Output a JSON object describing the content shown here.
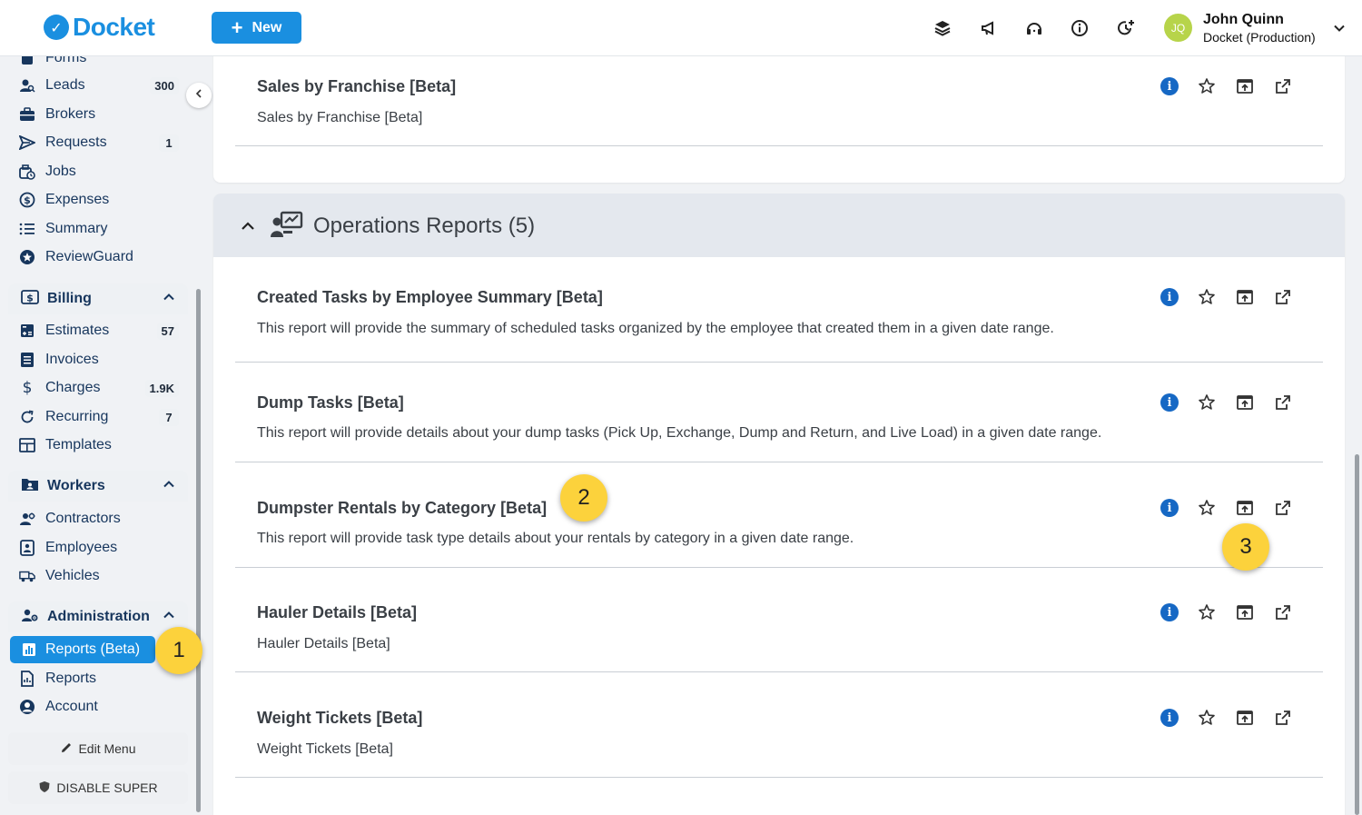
{
  "header": {
    "logo_text": "Docket",
    "new_button": "New",
    "user": {
      "initials": "JQ",
      "name": "John Quinn",
      "org": "Docket (Production)"
    }
  },
  "sidebar": {
    "top_items": [
      {
        "label": "Forms",
        "icon": "forms-icon"
      },
      {
        "label": "Leads",
        "icon": "leads-icon",
        "count": "300"
      },
      {
        "label": "Brokers",
        "icon": "briefcase-icon"
      },
      {
        "label": "Requests",
        "icon": "send-icon",
        "count": "1"
      },
      {
        "label": "Jobs",
        "icon": "jobs-icon"
      },
      {
        "label": "Expenses",
        "icon": "dollar-circle-icon"
      },
      {
        "label": "Summary",
        "icon": "list-icon"
      },
      {
        "label": "ReviewGuard",
        "icon": "star-badge-icon"
      }
    ],
    "billing": {
      "title": "Billing",
      "items": [
        {
          "label": "Estimates",
          "count": "57"
        },
        {
          "label": "Invoices"
        },
        {
          "label": "Charges",
          "count": "1.9K"
        },
        {
          "label": "Recurring",
          "count": "7"
        },
        {
          "label": "Templates"
        }
      ]
    },
    "workers": {
      "title": "Workers",
      "items": [
        {
          "label": "Contractors"
        },
        {
          "label": "Employees"
        },
        {
          "label": "Vehicles"
        }
      ]
    },
    "administration": {
      "title": "Administration",
      "items": [
        {
          "label": "Reports (Beta)"
        },
        {
          "label": "Reports"
        },
        {
          "label": "Account"
        }
      ]
    },
    "edit_menu": "Edit Menu",
    "disable_super": "DISABLE SUPER"
  },
  "main": {
    "top_report": {
      "name": "Sales by Franchise [Beta]",
      "desc": "Sales by Franchise [Beta]"
    },
    "operations": {
      "title": "Operations Reports (5)",
      "reports": [
        {
          "name": "Created Tasks by Employee Summary [Beta]",
          "desc": "This report will provide the summary of scheduled tasks organized by the employee that created them in a given date range."
        },
        {
          "name": "Dump Tasks [Beta]",
          "desc": "This report will provide details about your dump tasks (Pick Up, Exchange, Dump and Return, and Live Load) in a given date range."
        },
        {
          "name": "Dumpster Rentals by Category [Beta]",
          "desc": "This report will provide task type details about your rentals by category in a given date range."
        },
        {
          "name": "Hauler Details [Beta]",
          "desc": "Hauler Details [Beta]"
        },
        {
          "name": "Weight Tickets [Beta]",
          "desc": "Weight Tickets [Beta]"
        }
      ]
    }
  },
  "markers": [
    "1",
    "2",
    "3"
  ],
  "colors": {
    "accent": "#1a8fe0",
    "marker": "#fcd23c",
    "info": "#1668c4"
  }
}
